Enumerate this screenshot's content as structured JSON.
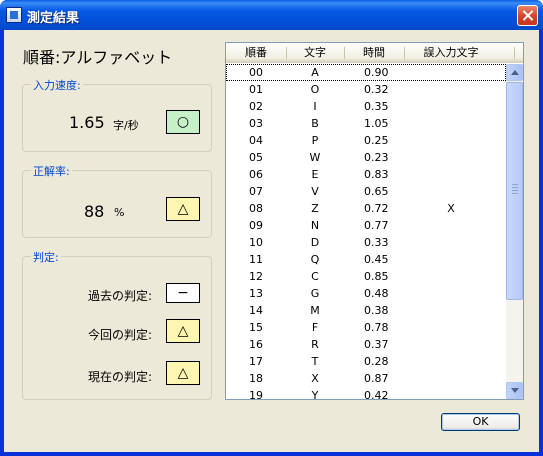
{
  "window": {
    "title": "測定結果"
  },
  "mode": {
    "label": "順番:アルファベット"
  },
  "speed": {
    "legend": "入力速度:",
    "value": "1.65",
    "unit": "字/秒",
    "mark": "○",
    "mark_color": "#c8f0c8"
  },
  "accuracy": {
    "legend": "正解率:",
    "value": "88",
    "unit": "%",
    "mark": "△",
    "mark_color": "#fdf6b0"
  },
  "judgement": {
    "legend": "判定:",
    "past_label": "過去の判定:",
    "past_mark": "−",
    "current_label": "今回の判定:",
    "current_mark": "△",
    "present_label": "現在の判定:",
    "present_mark": "△"
  },
  "table": {
    "columns": [
      "順番",
      "文字",
      "時間",
      "誤入力文字"
    ],
    "rows": [
      [
        "00",
        "A",
        "0.90",
        ""
      ],
      [
        "01",
        "O",
        "0.32",
        ""
      ],
      [
        "02",
        "I",
        "0.35",
        ""
      ],
      [
        "03",
        "B",
        "1.05",
        ""
      ],
      [
        "04",
        "P",
        "0.25",
        ""
      ],
      [
        "05",
        "W",
        "0.23",
        ""
      ],
      [
        "06",
        "E",
        "0.83",
        ""
      ],
      [
        "07",
        "V",
        "0.65",
        ""
      ],
      [
        "08",
        "Z",
        "0.72",
        "X"
      ],
      [
        "09",
        "N",
        "0.77",
        ""
      ],
      [
        "10",
        "D",
        "0.33",
        ""
      ],
      [
        "11",
        "Q",
        "0.45",
        ""
      ],
      [
        "12",
        "C",
        "0.85",
        ""
      ],
      [
        "13",
        "G",
        "0.48",
        ""
      ],
      [
        "14",
        "M",
        "0.38",
        ""
      ],
      [
        "15",
        "F",
        "0.78",
        ""
      ],
      [
        "16",
        "R",
        "0.37",
        ""
      ],
      [
        "17",
        "T",
        "0.28",
        ""
      ],
      [
        "18",
        "X",
        "0.87",
        ""
      ],
      [
        "19",
        "Y",
        "0.42",
        ""
      ]
    ]
  },
  "buttons": {
    "ok": "OK"
  }
}
